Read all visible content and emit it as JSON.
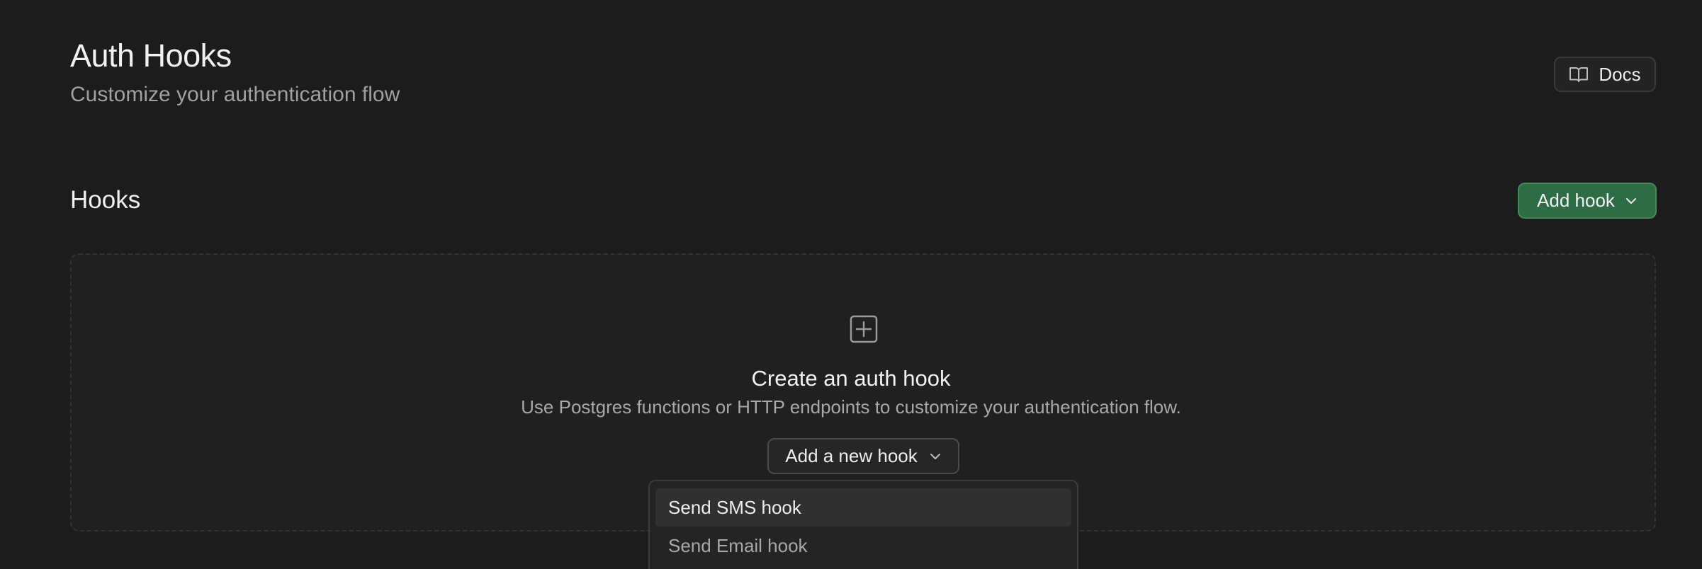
{
  "header": {
    "title": "Auth Hooks",
    "subtitle": "Customize your authentication flow",
    "docs_label": "Docs"
  },
  "hooks_section": {
    "title": "Hooks",
    "add_hook_label": "Add hook",
    "accent_color": "#2f6b44"
  },
  "empty_state": {
    "icon": "plus-square-icon",
    "title": "Create an auth hook",
    "description": "Use Postgres functions or HTTP endpoints to customize your authentication flow.",
    "add_new_hook_label": "Add a new hook"
  },
  "dropdown": {
    "items": [
      {
        "label": "Send SMS hook",
        "highlighted": true
      },
      {
        "label": "Send Email hook",
        "highlighted": false
      }
    ]
  }
}
